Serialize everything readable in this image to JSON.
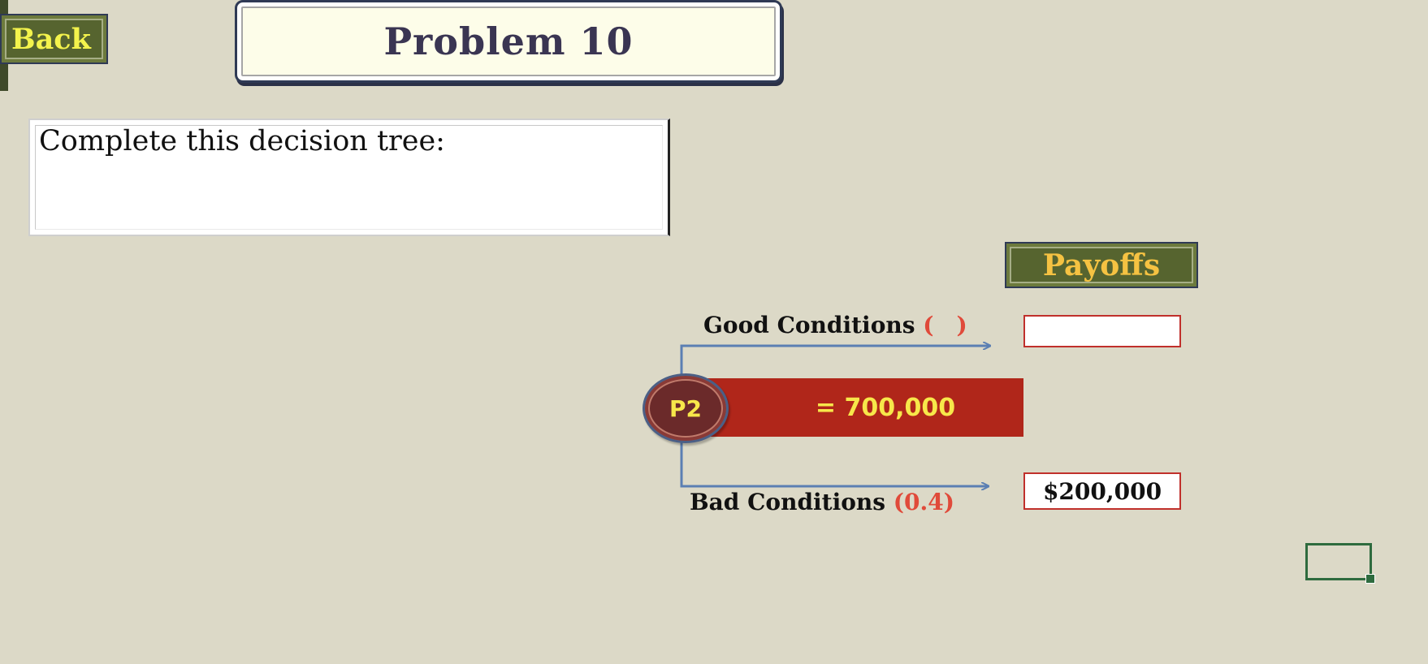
{
  "nav": {
    "back_label": "Back"
  },
  "header": {
    "title": "Problem 10"
  },
  "instruction": {
    "text": "Complete this decision tree:"
  },
  "tree": {
    "payoffs_header": "Payoffs",
    "good_branch": {
      "label": "Good Conditions",
      "prob_open": "(",
      "probability": "",
      "prob_close": ")",
      "payoff": ""
    },
    "bad_branch": {
      "label": "Bad Conditions",
      "probability": "(0.4)",
      "payoff": "$200,000"
    },
    "node_label": "P2",
    "expected_value_text": "= 700,000"
  },
  "colors": {
    "background": "#dcd9c7",
    "button_green": "#56642f",
    "back_text": "#f4f34c",
    "payoffs_text": "#f5c242",
    "ev_bar": "#b0261a",
    "ev_text": "#f7e74a",
    "probability_text": "#e04a3a",
    "branch_line": "#5b7fb3",
    "input_border": "#c0302b",
    "selection": "#2e6b3e"
  }
}
